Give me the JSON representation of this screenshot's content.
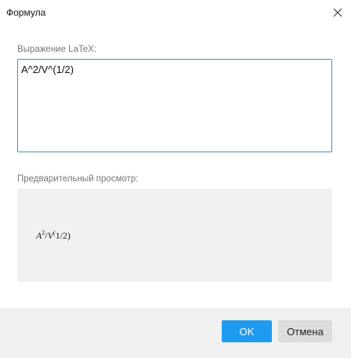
{
  "window": {
    "title": "Формула",
    "close_icon": "close-icon"
  },
  "latex": {
    "label": "Выражение LaTeX:",
    "value": "A^2/V^(1/2)"
  },
  "preview": {
    "label": "Предварительный просмотр:",
    "base1": "A",
    "exp1": "2",
    "slash": "/",
    "base2": "V",
    "exp2": "(",
    "rest": "1/2)"
  },
  "buttons": {
    "ok": "OK",
    "cancel": "Отмена"
  },
  "colors": {
    "accent": "#1e9bef",
    "input_border": "#3d8fd6",
    "footer_bg": "#f0f0f0",
    "preview_bg": "#f1f1f1"
  }
}
